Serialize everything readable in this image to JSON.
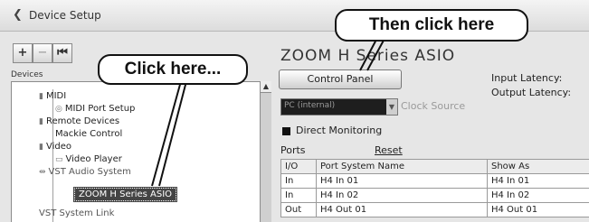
{
  "window": {
    "title": "Device Setup",
    "icon": "device-setup-icon"
  },
  "toolbar": {
    "add_label": "+",
    "remove_label": "−",
    "reset_label": "⏮"
  },
  "devices": {
    "heading": "Devices",
    "items": [
      {
        "label": "MIDI"
      },
      {
        "label": "MIDI Port Setup"
      },
      {
        "label": "Remote Devices"
      },
      {
        "label": "Mackie Control"
      },
      {
        "label": "Video"
      },
      {
        "label": "Video Player"
      },
      {
        "label": "VST Audio System"
      },
      {
        "label": "ZOOM H Series ASIO"
      },
      {
        "label": "VST System Link"
      }
    ]
  },
  "detail": {
    "device_title": "ZOOM H Series ASIO",
    "control_panel_label": "Control Panel",
    "input_latency_label": "Input Latency:",
    "output_latency_label": "Output Latency:",
    "clock_source_value": "PC (internal)",
    "clock_source_label": "Clock Source",
    "direct_monitoring_label": "Direct Monitoring",
    "ports_label": "Ports",
    "reset_label": "Reset"
  },
  "ports_table": {
    "headers": [
      "I/O",
      "Port System Name",
      "Show As"
    ],
    "rows": [
      [
        "In",
        "H4 In 01",
        "H4 In 01"
      ],
      [
        "In",
        "H4 In 02",
        "H4 In 02"
      ],
      [
        "Out",
        "H4 Out 01",
        "H4 Out 01"
      ]
    ]
  },
  "callouts": {
    "first": "Click here...",
    "second": "Then click here"
  }
}
